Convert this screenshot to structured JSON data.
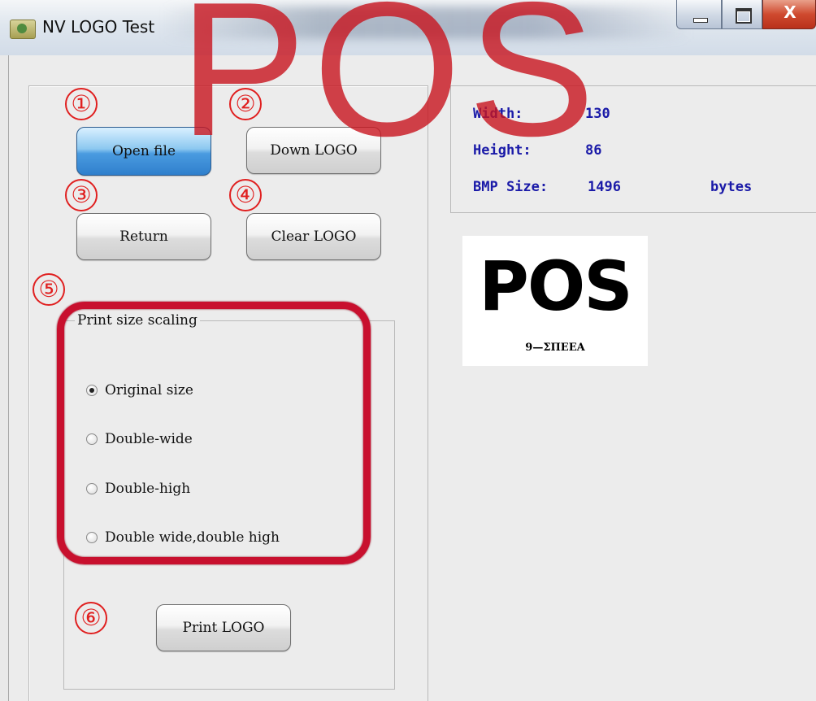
{
  "window": {
    "title": "NV LOGO Test",
    "close_glyph": "X"
  },
  "watermark": "POS",
  "steps": [
    "①",
    "②",
    "③",
    "④",
    "⑤",
    "⑥"
  ],
  "buttons": {
    "open_file": "Open file",
    "down_logo": "Down LOGO",
    "return": "Return",
    "clear_logo": "Clear LOGO",
    "print_logo": "Print LOGO"
  },
  "scaling": {
    "title": "Print size scaling",
    "selected": "Original size",
    "options": [
      "Original size",
      "Double-wide",
      "Double-high",
      "Double wide,double high"
    ]
  },
  "info": {
    "width_label": "Width:",
    "width_value": "130",
    "height_label": "Height:",
    "height_value": "86",
    "size_label": "BMP Size:",
    "size_value": "1496",
    "size_unit": "bytes"
  },
  "preview": {
    "big_text": "POS",
    "small_text": "9—ΣΠΕΕΑ"
  },
  "colors": {
    "highlight": "#c8102e",
    "info_text": "#1a1aa8",
    "watermark": "#c8141e"
  },
  "icons": [
    "app-icon",
    "minimize-icon",
    "maximize-icon",
    "close-icon"
  ]
}
